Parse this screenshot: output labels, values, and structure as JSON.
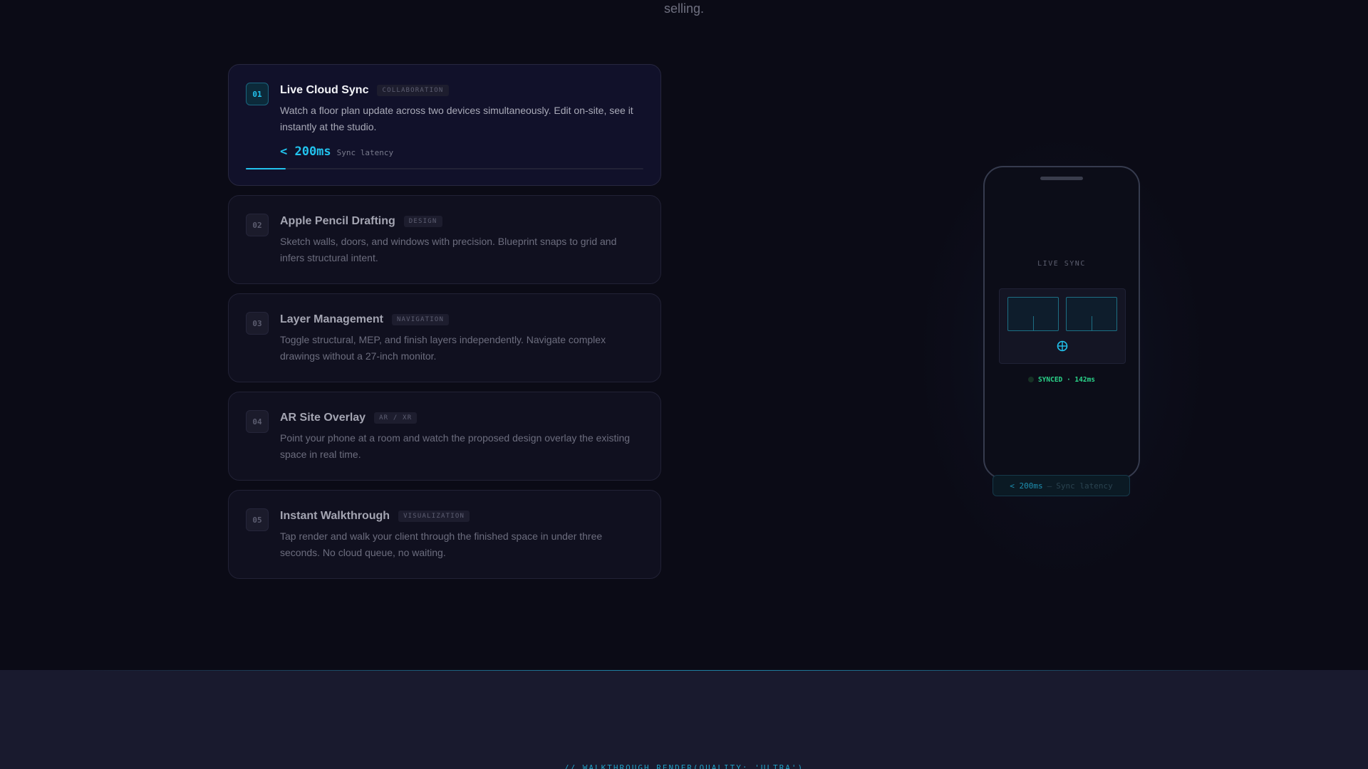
{
  "header": {
    "top_text": "selling."
  },
  "features": [
    {
      "number": "01",
      "title": "Live Cloud Sync",
      "tag": "COLLABORATION",
      "description": "Watch a floor plan update across two devices simultaneously. Edit on-site, see it instantly at the studio.",
      "metric_value": "< 200ms",
      "metric_label": "Sync latency",
      "progress": 0.1,
      "active": true
    },
    {
      "number": "02",
      "title": "Apple Pencil Drafting",
      "tag": "DESIGN",
      "description": "Sketch walls, doors, and windows with precision. Blueprint snaps to grid and infers structural intent."
    },
    {
      "number": "03",
      "title": "Layer Management",
      "tag": "NAVIGATION",
      "description": "Toggle structural, MEP, and finish layers independently. Navigate complex drawings without a 27-inch monitor."
    },
    {
      "number": "04",
      "title": "AR Site Overlay",
      "tag": "AR / XR",
      "description": "Point your phone at a room and watch the proposed design overlay the existing space in real time."
    },
    {
      "number": "05",
      "title": "Instant Walkthrough",
      "tag": "VISUALIZATION",
      "description": "Tap render and walk your client through the finished space in under three seconds. No cloud queue, no waiting."
    }
  ],
  "phone": {
    "screen_title": "LIVE SYNC",
    "status": "SYNCED · 142ms",
    "chip_value": "< 200ms",
    "chip_separator": "—",
    "chip_label": "Sync latency",
    "sync_icon": "sync-globe-icon"
  },
  "footer": {
    "code_line": "// WALKTHROUGH.RENDER(QUALITY: 'ULTRA')"
  },
  "colors": {
    "accent": "#22c3ee",
    "success": "#2bd48a",
    "background": "#0b0b16",
    "card": "#10101f"
  }
}
